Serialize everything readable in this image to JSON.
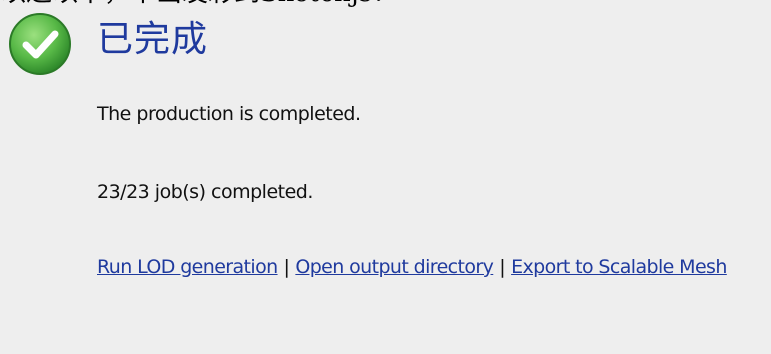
{
  "header_crop": "以达以下，中出发彩到Sketchjs：",
  "status": {
    "icon": "check-circle-icon",
    "title": "已完成",
    "color_title": "#1f3a9e",
    "color_icon": "#58b947"
  },
  "messages": {
    "production": "The production is completed.",
    "jobs": "23/23 job(s) completed."
  },
  "links": {
    "lod": "Run LOD generation",
    "separator1": "|",
    "open_dir": "Open output directory",
    "separator2": "|",
    "export": "Export to Scalable Mesh"
  }
}
